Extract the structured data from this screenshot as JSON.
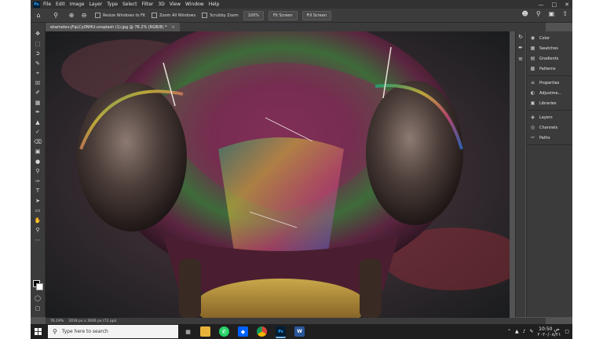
{
  "menu": {
    "app_logo": "Ps",
    "items": [
      "File",
      "Edit",
      "Image",
      "Layer",
      "Type",
      "Select",
      "Filter",
      "3D",
      "View",
      "Window",
      "Help"
    ]
  },
  "options_bar": {
    "resize_windows": "Resize Windows to Fit",
    "zoom_all_windows": "Zoom All Windows",
    "scrubby_zoom": "Scrubby Zoom",
    "zoom_100": "100%",
    "fit_screen": "Fit Screen",
    "fill_screen": "Fill Screen"
  },
  "document": {
    "tab_title": "ekamelev-jFqLCy0NHU-unsplash (1).jpg @ 76.2% (RGB/8) *",
    "status_zoom": "76.19%",
    "status_size": "3018 px x 3926 px (72 ppi)"
  },
  "panels": {
    "group1": [
      "Color",
      "Swatches",
      "Gradients",
      "Patterns"
    ],
    "group2": [
      "Properties",
      "Adjustme...",
      "Libraries"
    ],
    "group3": [
      "Layers",
      "Channels",
      "Paths"
    ]
  },
  "taskbar": {
    "search_placeholder": "Type here to search",
    "time": "10:50 ص",
    "date": "٢٠٢٠/٠٨/٢١"
  },
  "colors": {
    "ps_blue": "#31a8ff",
    "chrome_dark": "#323232",
    "panel_bg": "#3b3b3b",
    "workspace_bg": "#535353"
  }
}
